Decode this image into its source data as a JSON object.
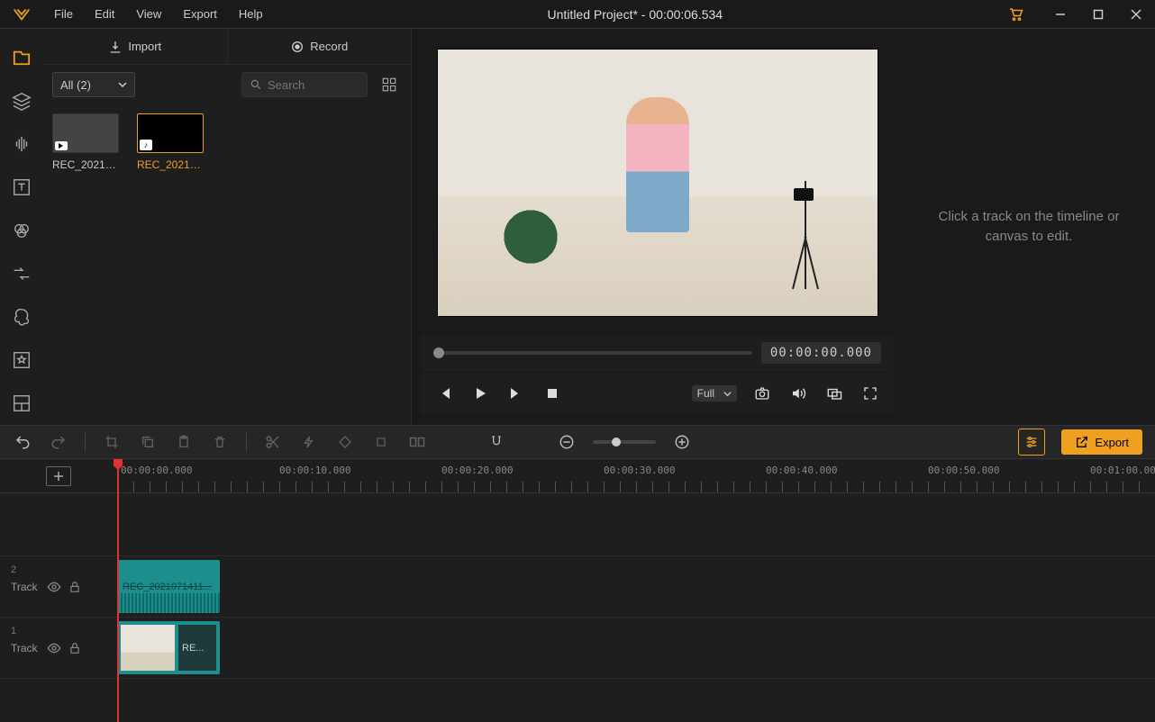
{
  "titlebar": {
    "title": "Untitled Project* - 00:00:06.534"
  },
  "menu": {
    "file": "File",
    "edit": "Edit",
    "view": "View",
    "export": "Export",
    "help": "Help"
  },
  "tabs": {
    "import": "Import",
    "record": "Record"
  },
  "filter": {
    "label": "All (2)"
  },
  "search": {
    "placeholder": "Search"
  },
  "media": {
    "items": [
      {
        "name": "REC_20210...",
        "type": "video",
        "selected": false
      },
      {
        "name": "REC_20210...",
        "type": "audio",
        "selected": true
      }
    ]
  },
  "preview": {
    "timecode": "00:00:00.000",
    "full_label": "Full"
  },
  "rightpanel": {
    "hint": "Click a track on the timeline or canvas to edit."
  },
  "toolbar": {
    "export_label": "Export"
  },
  "ruler": {
    "ticks": [
      "00:00:00.000",
      "00:00:10.000",
      "00:00:20.000",
      "00:00:30.000",
      "00:00:40.000",
      "00:00:50.000",
      "00:01:00.00"
    ]
  },
  "tracks": {
    "t2": {
      "num": "2",
      "label": "Track",
      "clip": "REC_2021071411..."
    },
    "t1": {
      "num": "1",
      "label": "Track",
      "clip": "RE..."
    }
  }
}
